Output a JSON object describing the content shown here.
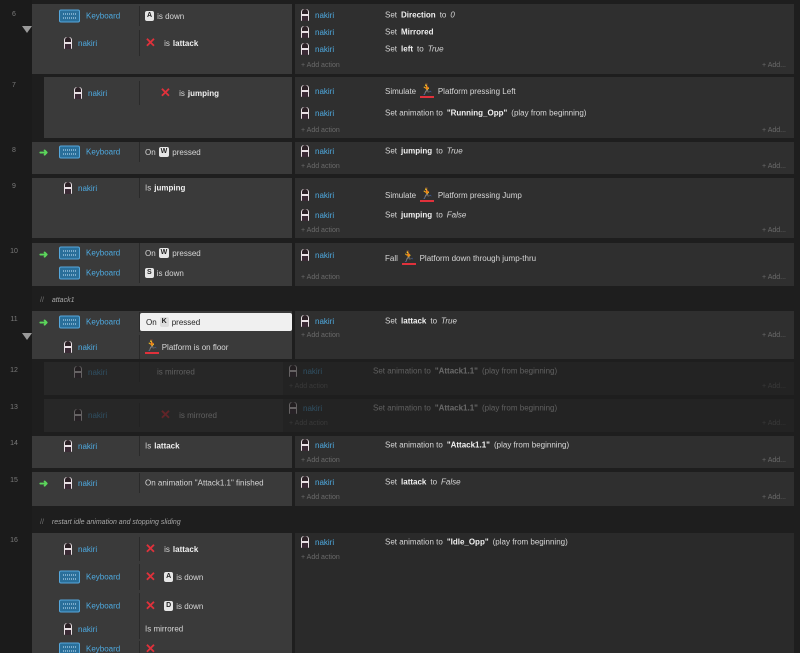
{
  "accent": "#4ea9df",
  "line_numbers": [
    "6",
    "7",
    "8",
    "9",
    "10",
    "11",
    "12",
    "13",
    "14",
    "15",
    "16"
  ],
  "add_action": "Add action",
  "add_more": "Add...",
  "comments": [
    "attack1",
    "restart idle animation and stopping sliding"
  ],
  "objects": {
    "keyboard": "Keyboard",
    "nakiri": "nakiri"
  },
  "ev6": {
    "c1_key": "A",
    "c1_text": "is down",
    "c2_text": "is",
    "c2_bold": "lattack",
    "a1": "Set",
    "a1_bold": "Direction",
    "a1_mid": "to",
    "a1_val": "0",
    "a2": "Set",
    "a2_bold": "Mirrored",
    "a3": "Set",
    "a3_bold": "left",
    "a3_mid": "to",
    "a3_val": "True"
  },
  "ev7": {
    "c1_text": "is",
    "c1_bold": "jumping",
    "a1_pre": "Simulate",
    "a1_post": "Platform pressing Left",
    "a2_pre": "Set animation to",
    "a2_bold": "\"Running_Opp\"",
    "a2_post": "(play from beginning)"
  },
  "ev8": {
    "c1_on": "On",
    "c1_key": "W",
    "c1_post": "pressed",
    "a1": "Set",
    "a1_bold": "jumping",
    "a1_mid": "to",
    "a1_val": "True"
  },
  "ev9": {
    "c1_text": "Is",
    "c1_bold": "jumping",
    "a1_pre": "Simulate",
    "a1_post": "Platform pressing Jump",
    "a2": "Set",
    "a2_bold": "jumping",
    "a2_mid": "to",
    "a2_val": "False"
  },
  "ev10": {
    "c1_on": "On",
    "c1_key": "W",
    "c1_post": "pressed",
    "c2_key": "S",
    "c2_text": "is down",
    "a1_pre": "Fall",
    "a1_post": "Platform down through jump-thru"
  },
  "ev11": {
    "c1_on": "On",
    "c1_key": "K",
    "c1_post": "pressed",
    "c2_text": "Platform is on floor",
    "a1": "Set",
    "a1_bold": "lattack",
    "a1_mid": "to",
    "a1_val": "True"
  },
  "ev12": {
    "c1_text": "is mirrored",
    "a1_pre": "Set animation to",
    "a1_bold": "\"Attack1.1\"",
    "a1_post": "(play from beginning)"
  },
  "ev13": {
    "c1_text": "is mirrored",
    "a1_pre": "Set animation to",
    "a1_bold": "\"Attack1.1\"",
    "a1_post": "(play from beginning)"
  },
  "ev14": {
    "c1_text": "Is",
    "c1_bold": "lattack",
    "a1_pre": "Set animation to",
    "a1_bold": "\"Attack1.1\"",
    "a1_post": "(play from beginning)"
  },
  "ev15": {
    "c1_text": "On animation \"Attack1.1\" finished",
    "a1": "Set",
    "a1_bold": "lattack",
    "a1_mid": "to",
    "a1_val": "False"
  },
  "ev16": {
    "c1_text": "is",
    "c1_bold": "lattack",
    "c2_key": "A",
    "c2_text": "is down",
    "c3_key": "D",
    "c3_text": "is down",
    "c4_text": "Is mirrored",
    "a1_pre": "Set animation to",
    "a1_bold": "\"Idle_Opp\"",
    "a1_post": "(play from beginning)"
  }
}
